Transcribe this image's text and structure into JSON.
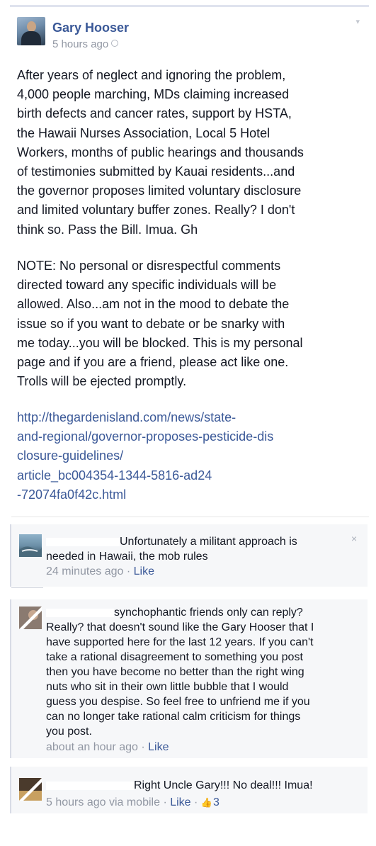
{
  "post": {
    "author": "Gary Hooser",
    "timestamp": "5 hours ago",
    "body_lines": [
      "After years of neglect and ignoring the problem,",
      "4,000 people marching, MDs claiming increased",
      "birth defects and cancer rates, support by HSTA,",
      "the Hawaii Nurses Association, Local 5 Hotel",
      "Workers, months of public hearings and thousands",
      "of testimonies submitted by Kauai residents...and",
      "the governor proposes limited voluntary disclosure",
      "and limited voluntary buffer zones. Really? I don't",
      "think so. Pass the Bill. Imua. Gh"
    ],
    "note_lines": [
      "NOTE: No personal or disrespectful comments",
      "directed toward any specific individuals will be",
      "allowed. Also...am not in the mood to debate the",
      "issue so if you want to debate or be snarky with",
      "me today...you will be blocked. This is my personal",
      "page and if you are a friend, please act like one.",
      "Trolls will be ejected promptly."
    ],
    "link_lines": [
      "http://thegardenisland.com/news/state-",
      "and-regional/governor-proposes-pesticide-dis",
      "closure-guidelines/",
      "article_bc004354-1344-5816-ad24",
      "-72074fa0f42c.html"
    ]
  },
  "comments": [
    {
      "lines": [
        "Unfortunately a militant approach is",
        "needed in Hawaii, the mob rules"
      ],
      "time": "24 minutes ago",
      "like_label": "Like",
      "close_icon": "×"
    },
    {
      "lines": [
        "synchophantic friends only can reply?",
        "Really? that doesn't sound like the Gary Hooser that I",
        "have supported here for the last 12 years. If you can't",
        "take a rational disagreement to something you post",
        "then you have become no better than the right wing",
        "nuts who sit in their own little bubble that I would",
        "guess you despise. So feel free to unfriend me if you",
        "can no longer take rational calm criticism for things",
        "you post."
      ],
      "time": "about an hour ago",
      "like_label": "Like"
    },
    {
      "lines": [
        "Right Uncle Gary!!! No deal!!! Imua!"
      ],
      "time": "5 hours ago via mobile",
      "like_label": "Like",
      "like_count": "3"
    }
  ],
  "separator": "·",
  "icons": [
    "avatar",
    "globe-icon",
    "chevron-down-icon",
    "close-icon",
    "thumbs-up-icon"
  ]
}
